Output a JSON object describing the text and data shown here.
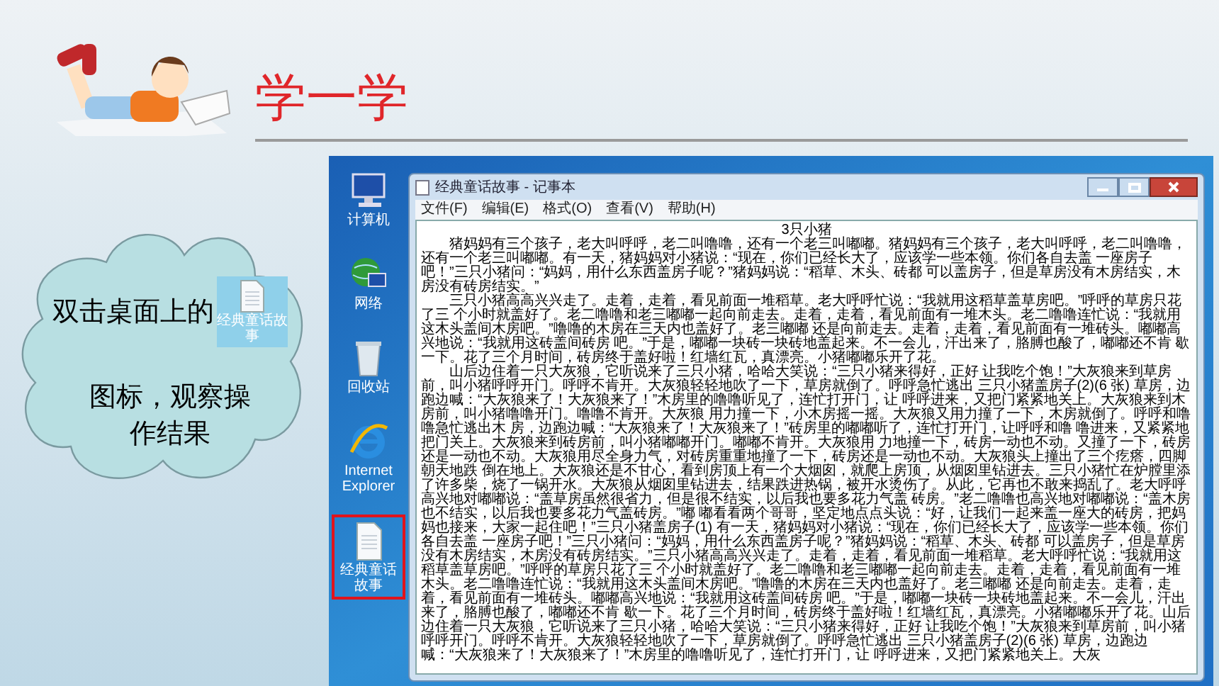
{
  "slide": {
    "title": "学一学"
  },
  "callout": {
    "text_before": "双击桌面上的",
    "icon_label": "经典童话故事",
    "text_after": "图标，观察操作结果"
  },
  "desktop": {
    "icons": [
      {
        "label": "计算机",
        "kind": "computer",
        "selected": false
      },
      {
        "label": "网络",
        "kind": "network",
        "selected": false
      },
      {
        "label": "回收站",
        "kind": "recycle-bin",
        "selected": false
      },
      {
        "label": "Internet Explorer",
        "kind": "browser",
        "selected": false
      },
      {
        "label": "经典童话故事",
        "kind": "text-file",
        "selected": true
      }
    ]
  },
  "notepad": {
    "title": "经典童话故事 - 记事本",
    "menu": [
      "文件(F)",
      "编辑(E)",
      "格式(O)",
      "查看(V)",
      "帮助(H)"
    ],
    "heading": "3只小猪",
    "paragraphs": [
      "猪妈妈有三个孩子，老大叫呼呼，老二叫噜噜，还有一个老三叫嘟嘟。猪妈妈有三个孩子，老大叫呼呼，老二叫噜噜，还有一个老三叫嘟嘟。有一天，猪妈妈对小猪说：“现在，你们已经长大了，应该学一些本领。你们各自去盖 一座房子吧！”三只小猪问：“妈妈，用什么东西盖房子呢？”猪妈妈说：“稻草、木头、砖都 可以盖房子，但是草房没有木房结实，木房没有砖房结实。”",
      "三只小猪高高兴兴走了。走着，走着，看见前面一堆稻草。老大呼呼忙说：“我就用这稻草盖草房吧。”呼呼的草房只花了三 个小时就盖好了。老二噜噜和老三嘟嘟一起向前走去。走着，走着，看见前面有一堆木头。老二噜噜连忙说：“我就用这木头盖间木房吧。”噜噜的木房在三天内也盖好了。老三嘟嘟 还是向前走去。走着，走着，看见前面有一堆砖头。嘟嘟高兴地说：“我就用这砖盖间砖房 吧。”于是，嘟嘟一块砖一块砖地盖起来。不一会儿，汗出来了，胳膊也酸了，嘟嘟还不肯 歇一下。花了三个月时间，砖房终于盖好啦！红墙红瓦，真漂亮。小猪嘟嘟乐开了花。",
      "山后边住着一只大灰狼，它听说来了三只小猪，哈哈大笑说：“三只小猪来得好，正好 让我吃个饱！”大灰狼来到草房前，叫小猪呼呼开门。呼呼不肯开。大灰狼轻轻地吹了一下，草房就倒了。呼呼急忙逃出 三只小猪盖房子(2)(6 张) 草房，边跑边喊：“大灰狼来了！大灰狼来了！”木房里的噜噜听见了，连忙打开门，让 呼呼进来，又把门紧紧地关上。大灰狼来到木房前，叫小猪噜噜开门。噜噜不肯开。大灰狼 用力撞一下，小木房摇一摇。大灰狼又用力撞了一下，木房就倒了。呼呼和噜噜急忙逃出木 房，边跑边喊：“大灰狼来了！大灰狼来了！”砖房里的嘟嘟听了，连忙打开门，让呼呼和噜 噜进来，又紧紧地把门关上。大灰狼来到砖房前，叫小猪嘟嘟开门。嘟嘟不肯开。大灰狼用 力地撞一下，砖房一动也不动。又撞了一下，砖房还是一动也不动。大灰狼用尽全身力气，对砖房重重地撞了一下，砖房还是一动也不动。大灰狼头上撞出了三个疙瘩，四脚朝天地跌 倒在地上。大灰狼还是不甘心，看到房顶上有一个大烟囱，就爬上房顶，从烟囱里钻进去。三只小猪忙在炉膛里添了许多柴，烧了一锅开水。大灰狼从烟囱里钻进去，结果跌进热锅，被开水烫伤了。从此，它再也不敢来捣乱了。老大呼呼高兴地对嘟嘟说：“盖草房虽然很省力，但是很不结实，以后我也要多花力气盖 砖房。”老二噜噜也高兴地对嘟嘟说：“盖木房也不结实，以后我也要多花力气盖砖房。”嘟 嘟看看两个哥哥，坚定地点点头说：“好，让我们一起来盖一座大的砖房，把妈妈也接来，大家一起住吧！”三只小猪盖房子(1) 有一天，猪妈妈对小猪说：“现在，你们已经长大了，应该学一些本领。你们各自去盖 一座房子吧！”三只小猪问：“妈妈，用什么东西盖房子呢？”猪妈妈说：“稻草、木头、砖都 可以盖房子，但是草房没有木房结实，木房没有砖房结实。”三只小猪高高兴兴走了。走着，走着，看见前面一堆稻草。老大呼呼忙说：“我就用这稻草盖草房吧。”呼呼的草房只花了三 个小时就盖好了。老二噜噜和老三嘟嘟一起向前走去。走着，走着，看见前面有一堆木头。老二噜噜连忙说：“我就用这木头盖间木房吧。”噜噜的木房在三天内也盖好了。老三嘟嘟 还是向前走去。走着，走着，看见前面有一堆砖头。嘟嘟高兴地说：“我就用这砖盖间砖房 吧。”于是，嘟嘟一块砖一块砖地盖起来。不一会儿，汗出来了，胳膊也酸了，嘟嘟还不肯 歇一下。花了三个月时间，砖房终于盖好啦！红墙红瓦，真漂亮。小猪嘟嘟乐开了花。山后边住着一只大灰狼，它听说来了三只小猪，哈哈大笑说：“三只小猪来得好，正好 让我吃个饱！”大灰狼来到草房前，叫小猪呼呼开门。呼呼不肯开。大灰狼轻轻地吹了一下，草房就倒了。呼呼急忙逃出 三只小猪盖房子(2)(6 张) 草房，边跑边喊：“大灰狼来了！大灰狼来了！”木房里的噜噜听见了，连忙打开门，让 呼呼进来，又把门紧紧地关上。大灰"
    ]
  }
}
